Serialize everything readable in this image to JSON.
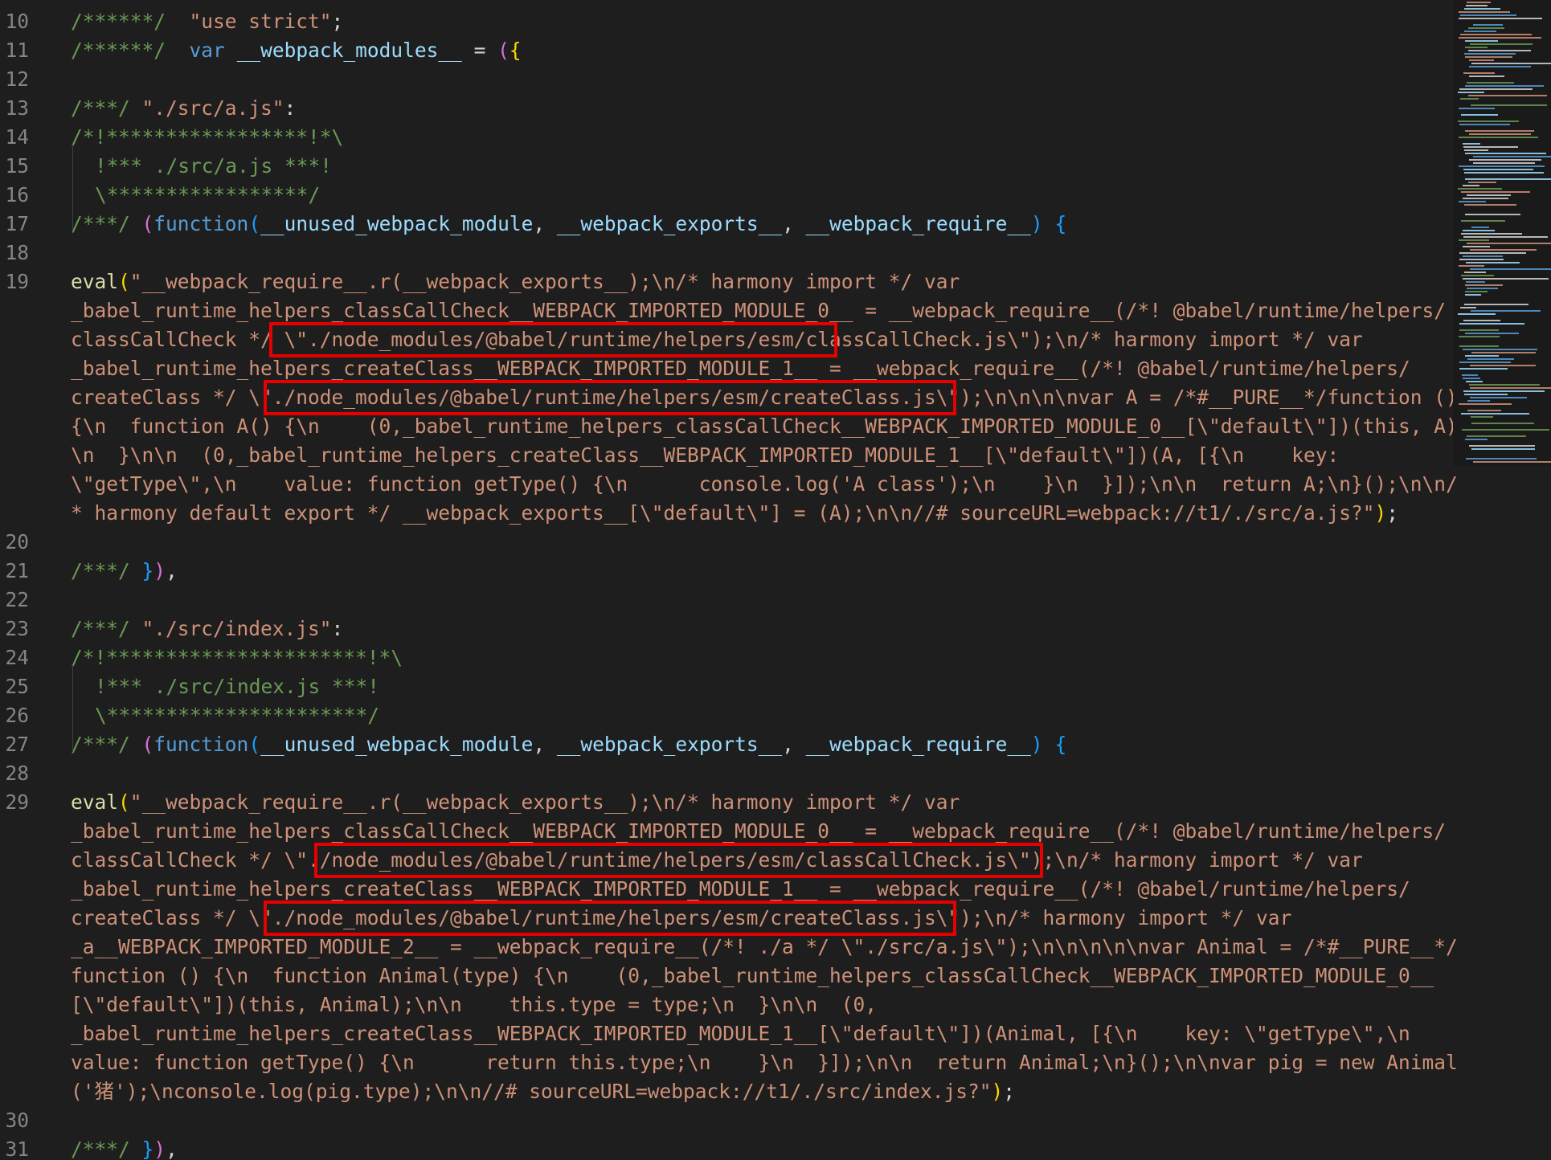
{
  "editor": {
    "lines": [
      {
        "n": "10",
        "tokens": [
          [
            "c",
            "/******/"
          ],
          [
            "p",
            "  "
          ],
          [
            "s",
            "\"use strict\""
          ],
          [
            "p",
            ";"
          ]
        ]
      },
      {
        "n": "11",
        "tokens": [
          [
            "c",
            "/******/"
          ],
          [
            "p",
            "  "
          ],
          [
            "k",
            "var"
          ],
          [
            "p",
            " "
          ],
          [
            "v",
            "__webpack_modules__"
          ],
          [
            "p",
            " = "
          ],
          [
            "b2",
            "("
          ],
          [
            "b1",
            "{"
          ]
        ]
      },
      {
        "n": "12",
        "tokens": []
      },
      {
        "n": "13",
        "tokens": [
          [
            "c",
            "/***/"
          ],
          [
            "p",
            " "
          ],
          [
            "s",
            "\"./src/a.js\""
          ],
          [
            "p",
            ":"
          ]
        ]
      },
      {
        "n": "14",
        "tokens": [
          [
            "c",
            "/*!*****************!*\\"
          ]
        ]
      },
      {
        "n": "15",
        "indent": true,
        "tokens": [
          [
            "c",
            "!*** ./src/a.js ***!"
          ]
        ]
      },
      {
        "n": "16",
        "indent": true,
        "tokens": [
          [
            "c",
            "\\*****************/"
          ]
        ]
      },
      {
        "n": "17",
        "tokens": [
          [
            "c",
            "/***/"
          ],
          [
            "p",
            " "
          ],
          [
            "b2",
            "("
          ],
          [
            "k",
            "function"
          ],
          [
            "b3",
            "("
          ],
          [
            "v",
            "__unused_webpack_module"
          ],
          [
            "p",
            ", "
          ],
          [
            "v",
            "__webpack_exports__"
          ],
          [
            "p",
            ", "
          ],
          [
            "v",
            "__webpack_require__"
          ],
          [
            "b3",
            ")"
          ],
          [
            "p",
            " "
          ],
          [
            "b3",
            "{"
          ]
        ]
      },
      {
        "n": "18",
        "tokens": []
      },
      {
        "n": "19",
        "tokens": [
          [
            "f",
            "eval"
          ],
          [
            "b1",
            "("
          ],
          [
            "s",
            "\"__webpack_require__.r(__webpack_exports__);\\n/* harmony import */ var"
          ]
        ]
      },
      {
        "n": "",
        "tokens": [
          [
            "s",
            "_babel_runtime_helpers_classCallCheck__WEBPACK_IMPORTED_MODULE_0__ = __webpack_require__(/*! @babel/runtime/helpers/"
          ]
        ]
      },
      {
        "n": "",
        "tokens": [
          [
            "s",
            "classCallCheck */ \\\"./node_modules/@babel/runtime/helpers/esm/classCallCheck.js\\\");\\n/* harmony import */ var"
          ]
        ]
      },
      {
        "n": "",
        "tokens": [
          [
            "s",
            "_babel_runtime_helpers_createClass__WEBPACK_IMPORTED_MODULE_1__ = __webpack_require__(/*! @babel/runtime/helpers/"
          ]
        ]
      },
      {
        "n": "",
        "tokens": [
          [
            "s",
            "createClass */ \\\"./node_modules/@babel/runtime/helpers/esm/createClass.js\\\");\\n\\n\\n\\nvar A = /*#__PURE__*/function ()"
          ]
        ]
      },
      {
        "n": "",
        "tokens": [
          [
            "s",
            "{\\n  function A() {\\n    (0,_babel_runtime_helpers_classCallCheck__WEBPACK_IMPORTED_MODULE_0__[\\\"default\\\"])(this, A);"
          ]
        ]
      },
      {
        "n": "",
        "tokens": [
          [
            "s",
            "\\n  }\\n\\n  (0,_babel_runtime_helpers_createClass__WEBPACK_IMPORTED_MODULE_1__[\\\"default\\\"])(A, [{\\n    key:"
          ]
        ]
      },
      {
        "n": "",
        "tokens": [
          [
            "s",
            "\\\"getType\\\",\\n    value: function getType() {\\n      console.log('A class');\\n    }\\n  }]);\\n\\n  return A;\\n}();\\n\\n/"
          ]
        ]
      },
      {
        "n": "",
        "tokens": [
          [
            "s",
            "* harmony default export */ __webpack_exports__[\\\"default\\\"] = (A);\\n\\n//# sourceURL=webpack://t1/./src/a.js?\""
          ],
          [
            "b1",
            ")"
          ],
          [
            "p",
            ";"
          ]
        ]
      },
      {
        "n": "20",
        "tokens": []
      },
      {
        "n": "21",
        "tokens": [
          [
            "c",
            "/***/"
          ],
          [
            "p",
            " "
          ],
          [
            "b3",
            "}"
          ],
          [
            "b2",
            ")"
          ],
          [
            "p",
            ","
          ]
        ]
      },
      {
        "n": "22",
        "tokens": []
      },
      {
        "n": "23",
        "tokens": [
          [
            "c",
            "/***/"
          ],
          [
            "p",
            " "
          ],
          [
            "s",
            "\"./src/index.js\""
          ],
          [
            "p",
            ":"
          ]
        ]
      },
      {
        "n": "24",
        "tokens": [
          [
            "c",
            "/*!**********************!*\\"
          ]
        ]
      },
      {
        "n": "25",
        "indent": true,
        "tokens": [
          [
            "c",
            "!*** ./src/index.js ***!"
          ]
        ]
      },
      {
        "n": "26",
        "indent": true,
        "tokens": [
          [
            "c",
            "\\**********************/"
          ]
        ]
      },
      {
        "n": "27",
        "tokens": [
          [
            "c",
            "/***/"
          ],
          [
            "p",
            " "
          ],
          [
            "b2",
            "("
          ],
          [
            "k",
            "function"
          ],
          [
            "b3",
            "("
          ],
          [
            "v",
            "__unused_webpack_module"
          ],
          [
            "p",
            ", "
          ],
          [
            "v",
            "__webpack_exports__"
          ],
          [
            "p",
            ", "
          ],
          [
            "v",
            "__webpack_require__"
          ],
          [
            "b3",
            ")"
          ],
          [
            "p",
            " "
          ],
          [
            "b3",
            "{"
          ]
        ]
      },
      {
        "n": "28",
        "tokens": []
      },
      {
        "n": "29",
        "tokens": [
          [
            "f",
            "eval"
          ],
          [
            "b1",
            "("
          ],
          [
            "s",
            "\"__webpack_require__.r(__webpack_exports__);\\n/* harmony import */ var"
          ]
        ]
      },
      {
        "n": "",
        "tokens": [
          [
            "s",
            "_babel_runtime_helpers_classCallCheck__WEBPACK_IMPORTED_MODULE_0__ = __webpack_require__(/*! @babel/runtime/helpers/"
          ]
        ]
      },
      {
        "n": "",
        "tokens": [
          [
            "s",
            "classCallCheck */ \\\"./node_modules/@babel/runtime/helpers/esm/classCallCheck.js\\\");\\n/* harmony import */ var"
          ]
        ]
      },
      {
        "n": "",
        "tokens": [
          [
            "s",
            "_babel_runtime_helpers_createClass__WEBPACK_IMPORTED_MODULE_1__ = __webpack_require__(/*! @babel/runtime/helpers/"
          ]
        ]
      },
      {
        "n": "",
        "tokens": [
          [
            "s",
            "createClass */ \\\"./node_modules/@babel/runtime/helpers/esm/createClass.js\\\");\\n/* harmony import */ var"
          ]
        ]
      },
      {
        "n": "",
        "tokens": [
          [
            "s",
            "_a__WEBPACK_IMPORTED_MODULE_2__ = __webpack_require__(/*! ./a */ \\\"./src/a.js\\\");\\n\\n\\n\\n\\nvar Animal = /*#__PURE__*/"
          ]
        ]
      },
      {
        "n": "",
        "tokens": [
          [
            "s",
            "function () {\\n  function Animal(type) {\\n    (0,_babel_runtime_helpers_classCallCheck__WEBPACK_IMPORTED_MODULE_0__"
          ]
        ]
      },
      {
        "n": "",
        "tokens": [
          [
            "s",
            "[\\\"default\\\"])(this, Animal);\\n\\n    this.type = type;\\n  }\\n\\n  (0,"
          ]
        ]
      },
      {
        "n": "",
        "tokens": [
          [
            "s",
            "_babel_runtime_helpers_createClass__WEBPACK_IMPORTED_MODULE_1__[\\\"default\\\"])(Animal, [{\\n    key: \\\"getType\\\",\\n"
          ]
        ]
      },
      {
        "n": "",
        "tokens": [
          [
            "s",
            "value: function getType() {\\n      return this.type;\\n    }\\n  }]);\\n\\n  return Animal;\\n}();\\n\\nvar pig = new Animal"
          ]
        ]
      },
      {
        "n": "",
        "tokens": [
          [
            "s",
            "('猪');\\nconsole.log(pig.type);\\n\\n//# sourceURL=webpack://t1/./src/index.js?\""
          ],
          [
            "b1",
            ")"
          ],
          [
            "p",
            ";"
          ]
        ]
      },
      {
        "n": "30",
        "tokens": []
      },
      {
        "n": "31",
        "tokens": [
          [
            "c",
            "/***/"
          ],
          [
            "p",
            " "
          ],
          [
            "b3",
            "}"
          ],
          [
            "b2",
            ")"
          ],
          [
            "p",
            ","
          ]
        ]
      }
    ],
    "highlights": [
      {
        "row": 11,
        "label": "classCallCheck-import-a"
      },
      {
        "row": 13,
        "label": "createClass-import-a"
      },
      {
        "row": 29,
        "label": "classCallCheck-import-index"
      },
      {
        "row": 31,
        "label": "createClass-import-index"
      }
    ],
    "colors": {
      "background": "#1e1e1e",
      "comment": "#6a9955",
      "string": "#ce9178",
      "keyword": "#569cd6",
      "highlight_box": "#e60000"
    }
  }
}
